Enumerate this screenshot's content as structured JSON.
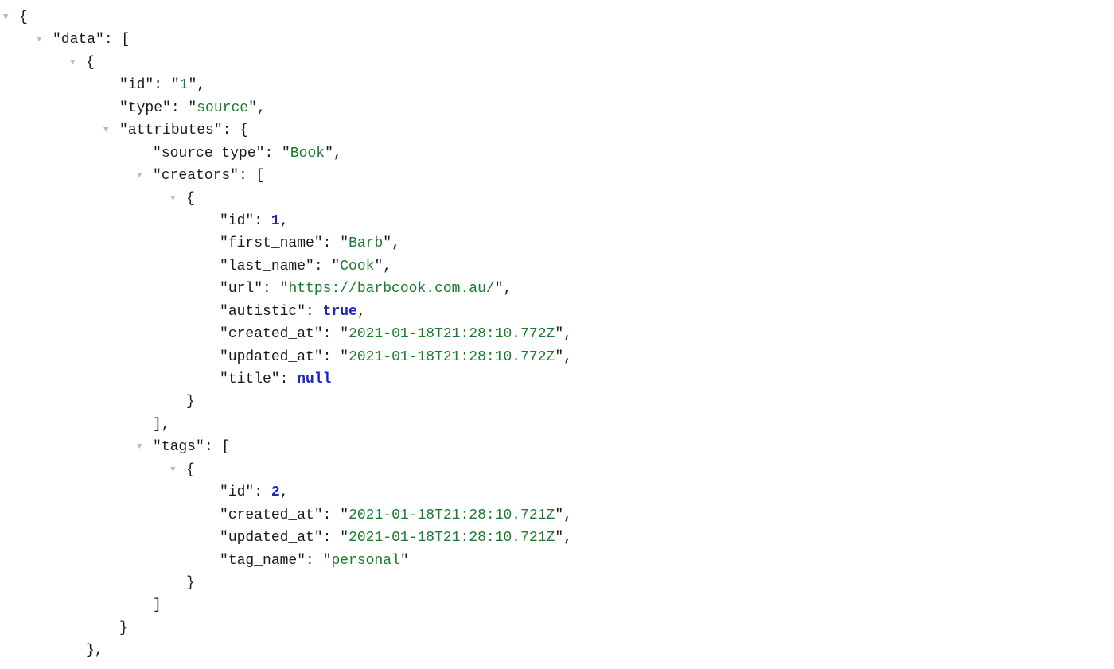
{
  "rows": [
    {
      "depth": 0,
      "caret": true,
      "tokens": [
        {
          "t": "p",
          "v": "{"
        }
      ]
    },
    {
      "depth": 1,
      "caret": true,
      "tokens": [
        {
          "t": "p",
          "v": "\""
        },
        {
          "t": "k",
          "v": "data"
        },
        {
          "t": "p",
          "v": "\": ["
        }
      ]
    },
    {
      "depth": 2,
      "caret": true,
      "tokens": [
        {
          "t": "p",
          "v": "{"
        }
      ]
    },
    {
      "depth": 3,
      "caret": false,
      "tokens": [
        {
          "t": "p",
          "v": "\""
        },
        {
          "t": "k",
          "v": "id"
        },
        {
          "t": "p",
          "v": "\": \""
        },
        {
          "t": "s",
          "v": "1"
        },
        {
          "t": "p",
          "v": "\","
        }
      ]
    },
    {
      "depth": 3,
      "caret": false,
      "tokens": [
        {
          "t": "p",
          "v": "\""
        },
        {
          "t": "k",
          "v": "type"
        },
        {
          "t": "p",
          "v": "\": \""
        },
        {
          "t": "s",
          "v": "source"
        },
        {
          "t": "p",
          "v": "\","
        }
      ]
    },
    {
      "depth": 3,
      "caret": true,
      "tokens": [
        {
          "t": "p",
          "v": "\""
        },
        {
          "t": "k",
          "v": "attributes"
        },
        {
          "t": "p",
          "v": "\": {"
        }
      ]
    },
    {
      "depth": 4,
      "caret": false,
      "tokens": [
        {
          "t": "p",
          "v": "\""
        },
        {
          "t": "k",
          "v": "source_type"
        },
        {
          "t": "p",
          "v": "\": \""
        },
        {
          "t": "s",
          "v": "Book"
        },
        {
          "t": "p",
          "v": "\","
        }
      ]
    },
    {
      "depth": 4,
      "caret": true,
      "tokens": [
        {
          "t": "p",
          "v": "\""
        },
        {
          "t": "k",
          "v": "creators"
        },
        {
          "t": "p",
          "v": "\": ["
        }
      ]
    },
    {
      "depth": 5,
      "caret": true,
      "tokens": [
        {
          "t": "p",
          "v": "{"
        }
      ]
    },
    {
      "depth": 6,
      "caret": false,
      "tokens": [
        {
          "t": "p",
          "v": "\""
        },
        {
          "t": "k",
          "v": "id"
        },
        {
          "t": "p",
          "v": "\": "
        },
        {
          "t": "n",
          "v": "1"
        },
        {
          "t": "p",
          "v": ","
        }
      ]
    },
    {
      "depth": 6,
      "caret": false,
      "tokens": [
        {
          "t": "p",
          "v": "\""
        },
        {
          "t": "k",
          "v": "first_name"
        },
        {
          "t": "p",
          "v": "\": \""
        },
        {
          "t": "s",
          "v": "Barb"
        },
        {
          "t": "p",
          "v": "\","
        }
      ]
    },
    {
      "depth": 6,
      "caret": false,
      "tokens": [
        {
          "t": "p",
          "v": "\""
        },
        {
          "t": "k",
          "v": "last_name"
        },
        {
          "t": "p",
          "v": "\": \""
        },
        {
          "t": "s",
          "v": "Cook"
        },
        {
          "t": "p",
          "v": "\","
        }
      ]
    },
    {
      "depth": 6,
      "caret": false,
      "tokens": [
        {
          "t": "p",
          "v": "\""
        },
        {
          "t": "k",
          "v": "url"
        },
        {
          "t": "p",
          "v": "\": \""
        },
        {
          "t": "s",
          "v": "https://barbcook.com.au/"
        },
        {
          "t": "p",
          "v": "\","
        }
      ]
    },
    {
      "depth": 6,
      "caret": false,
      "tokens": [
        {
          "t": "p",
          "v": "\""
        },
        {
          "t": "k",
          "v": "autistic"
        },
        {
          "t": "p",
          "v": "\": "
        },
        {
          "t": "kw",
          "v": "true"
        },
        {
          "t": "p",
          "v": ","
        }
      ]
    },
    {
      "depth": 6,
      "caret": false,
      "tokens": [
        {
          "t": "p",
          "v": "\""
        },
        {
          "t": "k",
          "v": "created_at"
        },
        {
          "t": "p",
          "v": "\": \""
        },
        {
          "t": "s",
          "v": "2021-01-18T21:28:10.772Z"
        },
        {
          "t": "p",
          "v": "\","
        }
      ]
    },
    {
      "depth": 6,
      "caret": false,
      "tokens": [
        {
          "t": "p",
          "v": "\""
        },
        {
          "t": "k",
          "v": "updated_at"
        },
        {
          "t": "p",
          "v": "\": \""
        },
        {
          "t": "s",
          "v": "2021-01-18T21:28:10.772Z"
        },
        {
          "t": "p",
          "v": "\","
        }
      ]
    },
    {
      "depth": 6,
      "caret": false,
      "tokens": [
        {
          "t": "p",
          "v": "\""
        },
        {
          "t": "k",
          "v": "title"
        },
        {
          "t": "p",
          "v": "\": "
        },
        {
          "t": "kw",
          "v": "null"
        }
      ]
    },
    {
      "depth": 5,
      "caret": false,
      "tokens": [
        {
          "t": "p",
          "v": "}"
        }
      ]
    },
    {
      "depth": 4,
      "caret": false,
      "tokens": [
        {
          "t": "p",
          "v": "],"
        }
      ]
    },
    {
      "depth": 4,
      "caret": true,
      "tokens": [
        {
          "t": "p",
          "v": "\""
        },
        {
          "t": "k",
          "v": "tags"
        },
        {
          "t": "p",
          "v": "\": ["
        }
      ]
    },
    {
      "depth": 5,
      "caret": true,
      "tokens": [
        {
          "t": "p",
          "v": "{"
        }
      ]
    },
    {
      "depth": 6,
      "caret": false,
      "tokens": [
        {
          "t": "p",
          "v": "\""
        },
        {
          "t": "k",
          "v": "id"
        },
        {
          "t": "p",
          "v": "\": "
        },
        {
          "t": "n",
          "v": "2"
        },
        {
          "t": "p",
          "v": ","
        }
      ]
    },
    {
      "depth": 6,
      "caret": false,
      "tokens": [
        {
          "t": "p",
          "v": "\""
        },
        {
          "t": "k",
          "v": "created_at"
        },
        {
          "t": "p",
          "v": "\": \""
        },
        {
          "t": "s",
          "v": "2021-01-18T21:28:10.721Z"
        },
        {
          "t": "p",
          "v": "\","
        }
      ]
    },
    {
      "depth": 6,
      "caret": false,
      "tokens": [
        {
          "t": "p",
          "v": "\""
        },
        {
          "t": "k",
          "v": "updated_at"
        },
        {
          "t": "p",
          "v": "\": \""
        },
        {
          "t": "s",
          "v": "2021-01-18T21:28:10.721Z"
        },
        {
          "t": "p",
          "v": "\","
        }
      ]
    },
    {
      "depth": 6,
      "caret": false,
      "tokens": [
        {
          "t": "p",
          "v": "\""
        },
        {
          "t": "k",
          "v": "tag_name"
        },
        {
          "t": "p",
          "v": "\": \""
        },
        {
          "t": "s",
          "v": "personal"
        },
        {
          "t": "p",
          "v": "\""
        }
      ]
    },
    {
      "depth": 5,
      "caret": false,
      "tokens": [
        {
          "t": "p",
          "v": "}"
        }
      ]
    },
    {
      "depth": 4,
      "caret": false,
      "tokens": [
        {
          "t": "p",
          "v": "]"
        }
      ]
    },
    {
      "depth": 3,
      "caret": false,
      "tokens": [
        {
          "t": "p",
          "v": "}"
        }
      ]
    },
    {
      "depth": 2,
      "caret": false,
      "tokens": [
        {
          "t": "p",
          "v": "},"
        }
      ]
    }
  ],
  "glyphs": {
    "caret_down": "▼"
  }
}
